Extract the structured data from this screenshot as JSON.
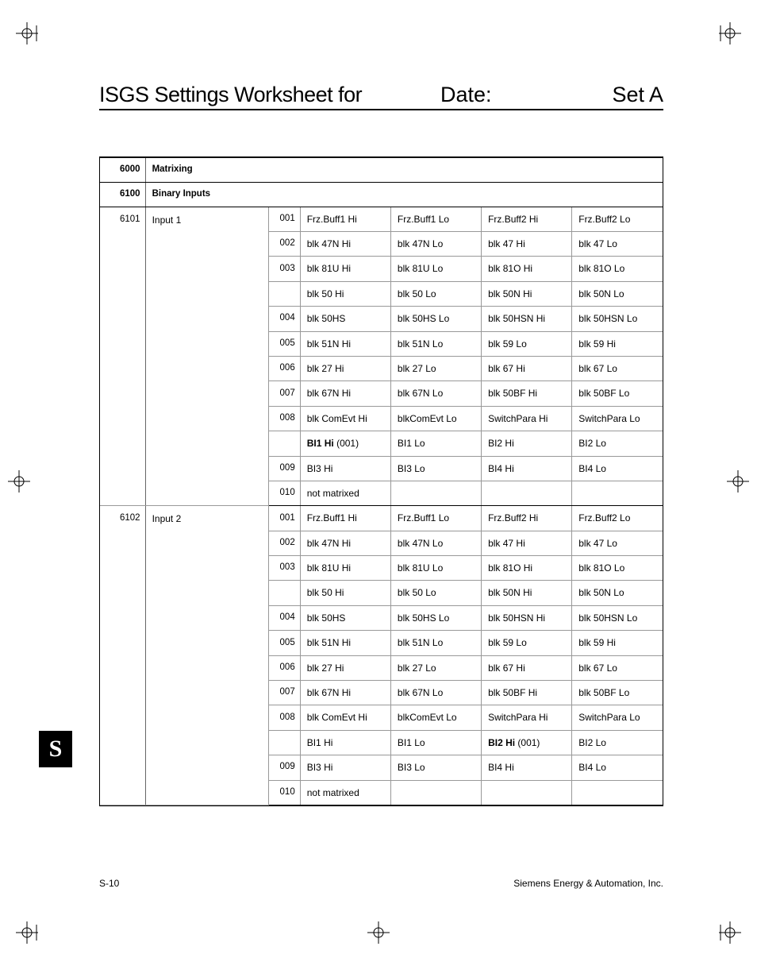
{
  "header": {
    "title": "ISGS Settings Worksheet for",
    "date_label": "Date:",
    "set_label": "Set A"
  },
  "side_tab": "S",
  "footer": {
    "page": "S-10",
    "company": "Siemens Energy & Automation, Inc."
  },
  "sections": [
    {
      "code": "6000",
      "name": "Matrixing"
    },
    {
      "code": "6100",
      "name": "Binary Inputs"
    }
  ],
  "inputs": [
    {
      "code": "6101",
      "name": "Input 1",
      "rows": [
        {
          "sub": "001",
          "c": [
            "Frz.Buff1 Hi",
            "Frz.Buff1 Lo",
            "Frz.Buff2 Hi",
            "Frz.Buff2 Lo"
          ]
        },
        {
          "sub": "002",
          "c": [
            "blk 47N Hi",
            "blk 47N Lo",
            "blk 47 Hi",
            "blk 47 Lo"
          ]
        },
        {
          "sub": "003",
          "c": [
            "blk 81U Hi",
            "blk 81U Lo",
            "blk 81O Hi",
            "blk 81O Lo"
          ]
        },
        {
          "sub": "",
          "c": [
            "blk 50 Hi",
            "blk 50 Lo",
            "blk 50N Hi",
            "blk 50N Lo"
          ]
        },
        {
          "sub": "004",
          "c": [
            "blk 50HS",
            "blk 50HS Lo",
            "blk 50HSN Hi",
            "blk 50HSN Lo"
          ]
        },
        {
          "sub": "005",
          "c": [
            "blk 51N Hi",
            "blk 51N Lo",
            "blk 59 Lo",
            "blk 59 Hi"
          ]
        },
        {
          "sub": "006",
          "c": [
            "blk 27 Hi",
            "blk 27 Lo",
            "blk 67 Hi",
            "blk 67 Lo"
          ]
        },
        {
          "sub": "007",
          "c": [
            "blk 67N Hi",
            "blk 67N Lo",
            "blk 50BF Hi",
            "blk 50BF Lo"
          ]
        },
        {
          "sub": "008",
          "c": [
            "blk ComEvt Hi",
            "blkComEvt Lo",
            "SwitchPara Hi",
            "SwitchPara Lo"
          ]
        },
        {
          "sub": "",
          "c": [
            "BI1 Hi",
            " (001)",
            "BI1 Lo",
            "BI2 Hi",
            "BI2 Lo"
          ],
          "bold_col": 0
        },
        {
          "sub": "009",
          "c": [
            "BI3 Hi",
            "BI3 Lo",
            "BI4 Hi",
            "BI4 Lo"
          ]
        },
        {
          "sub": "010",
          "c": [
            "not matrixed",
            "",
            "",
            ""
          ]
        }
      ]
    },
    {
      "code": "6102",
      "name": "Input 2",
      "rows": [
        {
          "sub": "001",
          "c": [
            "Frz.Buff1 Hi",
            "Frz.Buff1 Lo",
            "Frz.Buff2 Hi",
            "Frz.Buff2 Lo"
          ]
        },
        {
          "sub": "002",
          "c": [
            "blk 47N Hi",
            "blk 47N Lo",
            "blk 47 Hi",
            "blk 47 Lo"
          ]
        },
        {
          "sub": "003",
          "c": [
            "blk 81U Hi",
            "blk 81U Lo",
            "blk 81O Hi",
            "blk 81O Lo"
          ]
        },
        {
          "sub": "",
          "c": [
            "blk 50 Hi",
            "blk 50 Lo",
            "blk 50N Hi",
            "blk 50N Lo"
          ]
        },
        {
          "sub": "004",
          "c": [
            "blk 50HS",
            "blk 50HS Lo",
            "blk 50HSN Hi",
            "blk 50HSN Lo"
          ]
        },
        {
          "sub": "005",
          "c": [
            "blk 51N Hi",
            "blk 51N Lo",
            "blk 59 Lo",
            "blk 59 Hi"
          ]
        },
        {
          "sub": "006",
          "c": [
            "blk 27 Hi",
            "blk 27 Lo",
            "blk 67 Hi",
            "blk 67 Lo"
          ]
        },
        {
          "sub": "007",
          "c": [
            "blk 67N Hi",
            "blk 67N Lo",
            "blk 50BF Hi",
            "blk 50BF Lo"
          ]
        },
        {
          "sub": "008",
          "c": [
            "blk ComEvt Hi",
            "blkComEvt Lo",
            "SwitchPara Hi",
            "SwitchPara Lo"
          ]
        },
        {
          "sub": "",
          "c": [
            "BI1 Hi",
            "BI1 Lo",
            "BI2 Hi",
            " (001)",
            "BI2 Lo"
          ],
          "bold_col": 2
        },
        {
          "sub": "009",
          "c": [
            "BI3 Hi",
            "BI3 Lo",
            "BI4 Hi",
            "BI4 Lo"
          ]
        },
        {
          "sub": "010",
          "c": [
            "not matrixed",
            "",
            "",
            ""
          ]
        }
      ]
    }
  ]
}
